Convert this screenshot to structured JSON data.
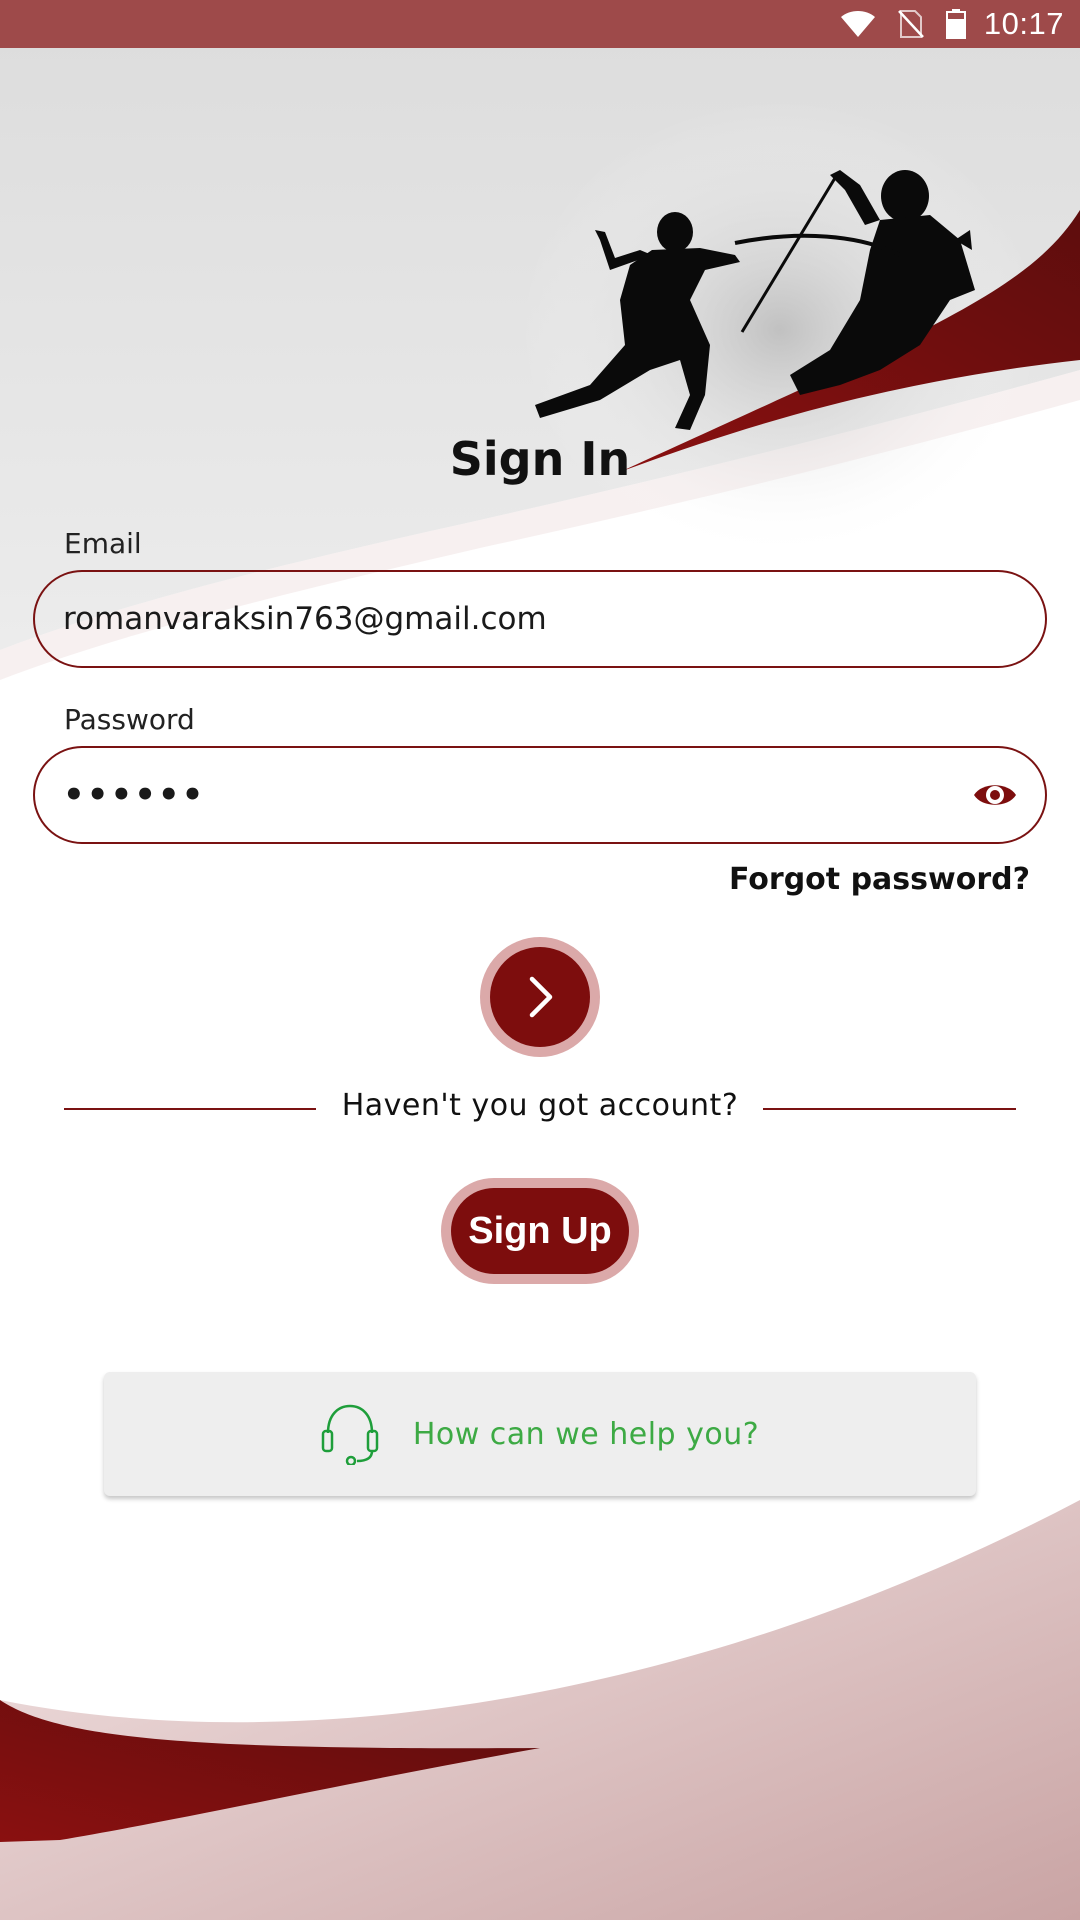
{
  "status_bar": {
    "time": "10:17",
    "icons": [
      "wifi-icon",
      "no-sim-icon",
      "battery-icon"
    ]
  },
  "header": {
    "title": "Sign In",
    "illustration": "fencers-silhouette"
  },
  "form": {
    "email_label": "Email",
    "email_value": "romanvaraksin763@gmail.com",
    "password_label": "Password",
    "password_value": "••••••",
    "forgot_label": "Forgot password?"
  },
  "divider": {
    "text": "Haven't you got account?"
  },
  "signup": {
    "label": "Sign Up"
  },
  "help": {
    "label": "How can we help you?",
    "icon": "headset-icon"
  },
  "colors": {
    "accent": "#7d0d0d",
    "accent_light": "#dba9a9",
    "status_bar": "#9e4a4a",
    "help_text": "#3daa44"
  }
}
